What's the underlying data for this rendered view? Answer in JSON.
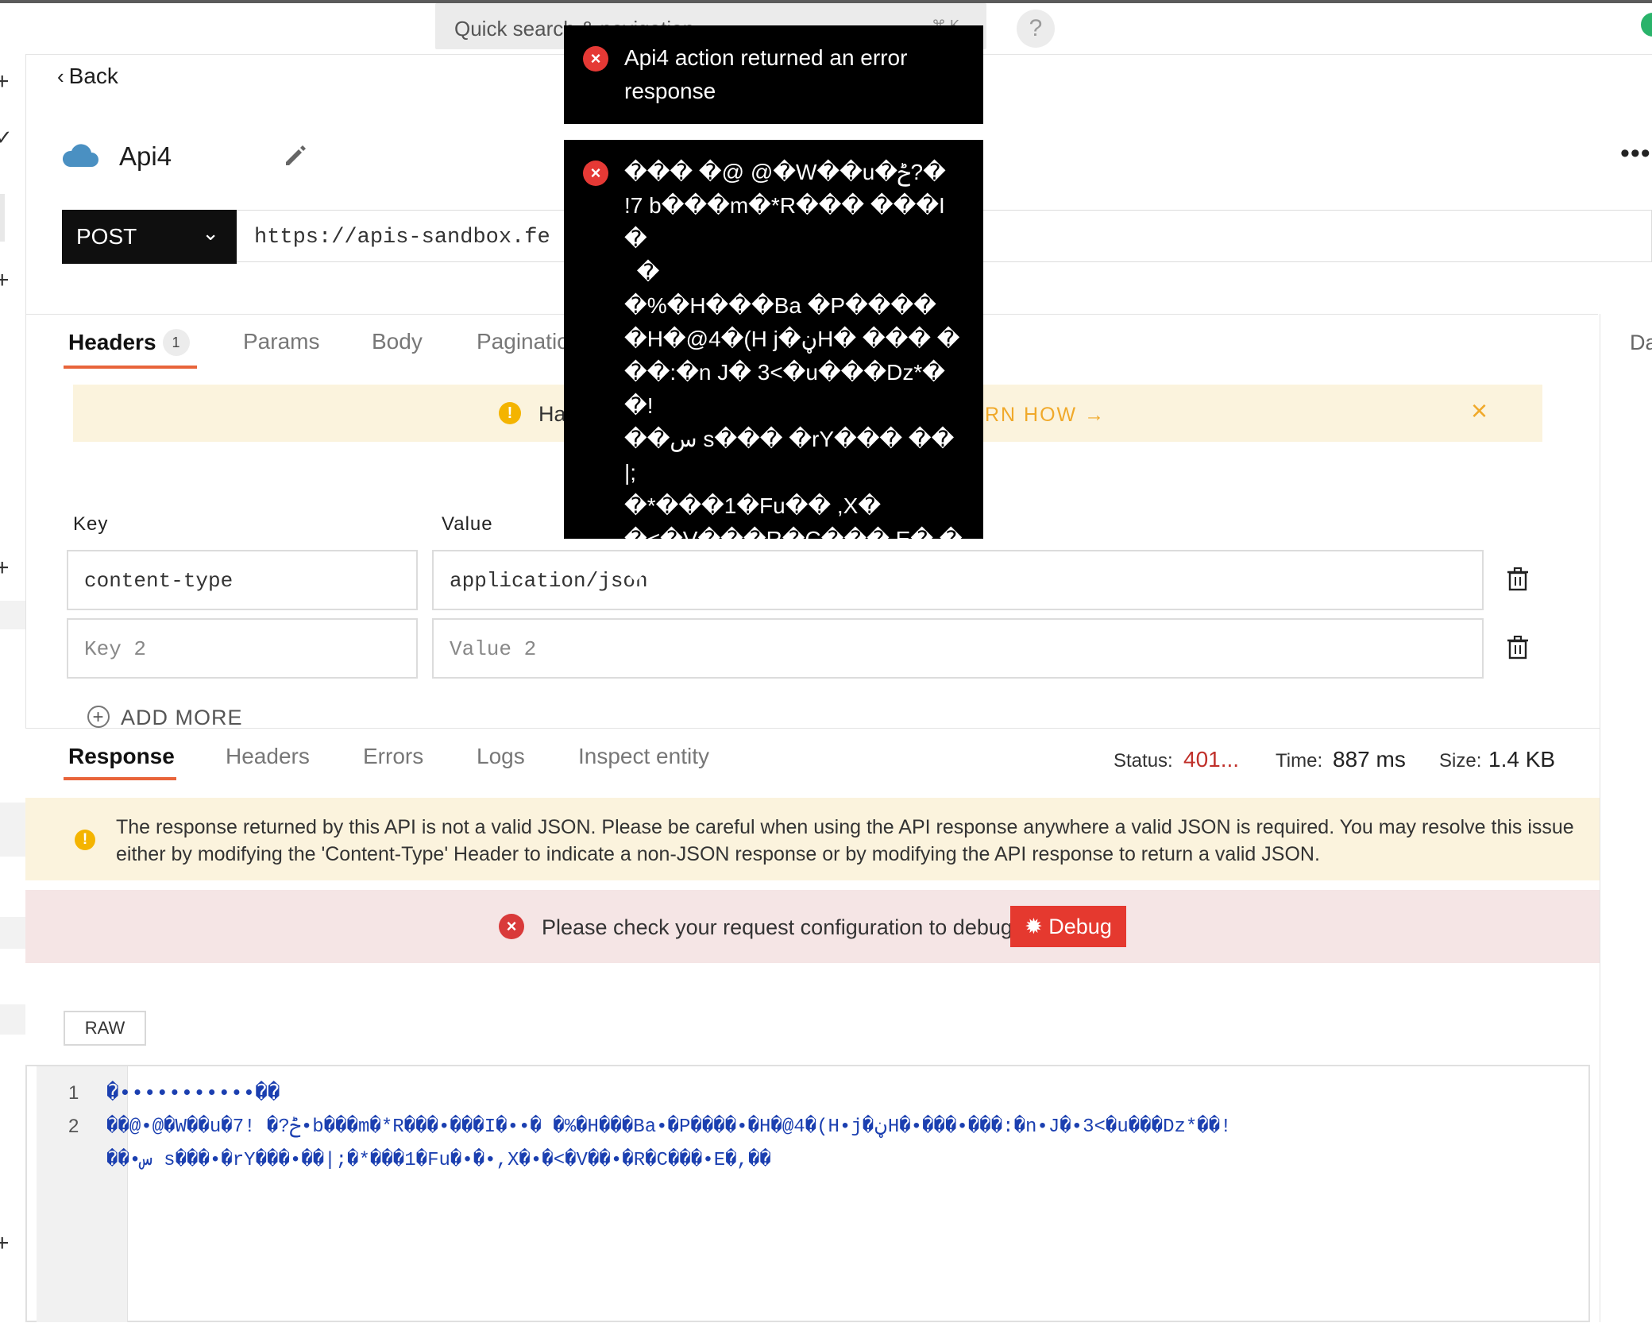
{
  "topbar": {
    "search_placeholder": "Quick search & navigation",
    "search_shortcut": "⌘ K",
    "help": "?"
  },
  "header": {
    "back": "Back",
    "api_name": "Api4",
    "method": "POST",
    "url": "https://apis-sandbox.fe",
    "side_panel_label": "Da"
  },
  "request_tabs": [
    {
      "label": "Headers",
      "badge": "1",
      "active": true
    },
    {
      "label": "Params"
    },
    {
      "label": "Body"
    },
    {
      "label": "Paginatio"
    }
  ],
  "hint_banner": {
    "text": "Ha",
    "link": "RN HOW →"
  },
  "headers_table": {
    "key_label": "Key",
    "value_label": "Value",
    "rows": [
      {
        "key": "content-type",
        "value": "application/json"
      },
      {
        "key_placeholder": "Key 2",
        "value_placeholder": "Value 2"
      }
    ],
    "add_more": "ADD MORE"
  },
  "response_tabs": [
    {
      "label": "Response",
      "active": true
    },
    {
      "label": "Headers"
    },
    {
      "label": "Errors"
    },
    {
      "label": "Logs"
    },
    {
      "label": "Inspect entity"
    }
  ],
  "response_meta": {
    "status_label": "Status:",
    "status_value": "401...",
    "time_label": "Time:",
    "time_value": "887 ms",
    "size_label": "Size:",
    "size_value": "1.4 KB"
  },
  "json_warning": "The response returned by this API is not a valid JSON. Please be careful when using the API response anywhere a valid JSON is required. You may resolve this issue either by modifying the 'Content-Type' Header to indicate a non-JSON response or by modifying the API response to return a valid JSON.",
  "debug_bar": {
    "text": "Please check your request configuration to debug",
    "button": "Debug"
  },
  "raw_button": "RAW",
  "editor": {
    "lines": [
      {
        "number": "1",
        "text": "�•••••••••••��"
      },
      {
        "number": "2",
        "text": "��@•@�W��u�ݲ?� !7•b���m�*R���•���I�••� �%�H���Ba•�P����•�H�@4�(H•j�ڼH�•���•���:�n•J�•3<�u���Dz*��!"
      },
      {
        "number": "",
        "text": "��•س s���•�rY���•��|;�*���1�Fu�•�•,X�•�<�V��•�R�C���•E�,��"
      }
    ]
  },
  "toasts": [
    {
      "message": "Api4 action returned an error response"
    },
    {
      "message": "��� �@ @�W��u�ݲ?�\n!7 b���m�*R��� ���I�\n  �\n�%�H���Ba �P����\n�H�@4�(H j�ڼH� ��� �\n��:�n J� 3<�u���Dz*�\n�!\n��س s��� �rY��� ��|;\n�*���1�Fu�� ,X�\n�<�V���R�C��� E�,�\n�"
    }
  ],
  "colors": {
    "accent": "#e8643a",
    "error": "#e53935",
    "status_error": "#c0302a",
    "warning_bg": "#fbf3dd",
    "debug_bg": "#f5e5e5",
    "method_bg": "#0f0f0f",
    "cloud": "#4a90c2"
  }
}
